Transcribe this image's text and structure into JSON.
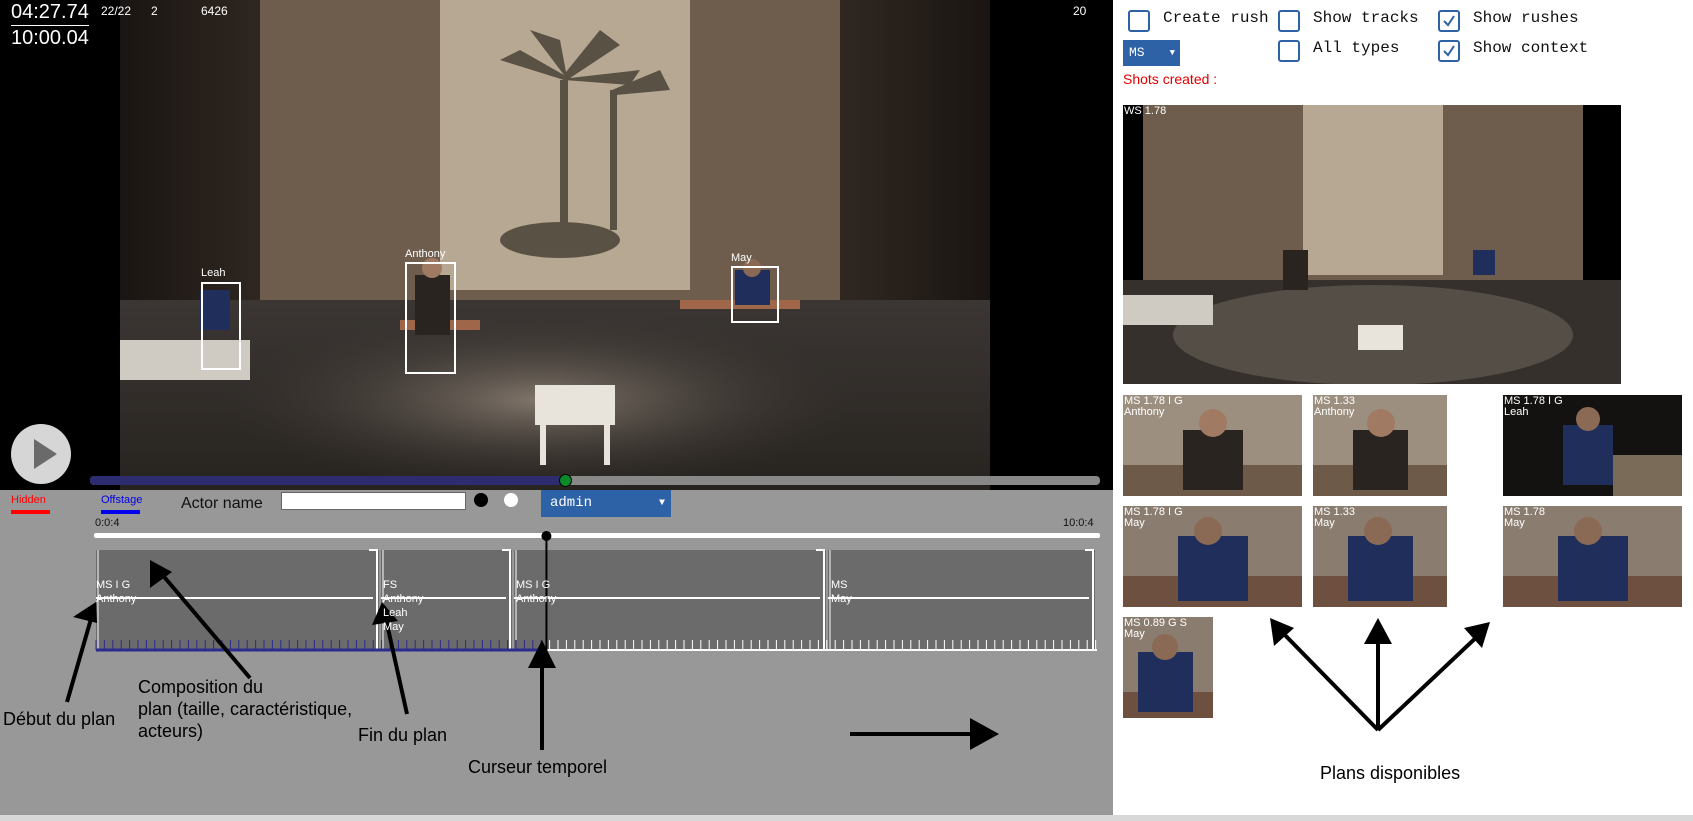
{
  "video": {
    "timecode": "04:27.74",
    "duration": "10:00.04",
    "frame_counter": "22/22",
    "stat_a": "2",
    "frame_number": "6426",
    "stat_b": "20",
    "progress": 0.47,
    "actors": [
      {
        "name": "Leah"
      },
      {
        "name": "Anthony"
      },
      {
        "name": "May"
      }
    ]
  },
  "controls": {
    "hidden_label": "Hidden",
    "offstage_label": "Offstage",
    "actor_name_label": "Actor name",
    "actor_name_value": "",
    "user_select": "admin",
    "hidden_color": "#ff0000",
    "offstage_color": "#0000ff"
  },
  "timeline": {
    "start_label": "0:0:4",
    "end_label": "10:0:4",
    "cursor_fraction": 0.45,
    "shots": [
      {
        "type": "MS I G",
        "actors": "Anthony"
      },
      {
        "type": "FS",
        "actors": "Anthony\nLeah\nMay"
      },
      {
        "type": "MS I G",
        "actors": "Anthony"
      },
      {
        "type": "MS",
        "actors": "May"
      }
    ]
  },
  "annotations": {
    "debut": "Début du plan",
    "composition": "Composition du\nplan (taille, caractéristique,\nacteurs)",
    "fin": "Fin du plan",
    "curseur": "Curseur temporel",
    "plans": "Plans disponibles"
  },
  "options": {
    "create_rush": {
      "label": "Create rush",
      "checked": false
    },
    "show_tracks": {
      "label": "Show tracks",
      "checked": false
    },
    "show_rushes": {
      "label": "Show rushes",
      "checked": true
    },
    "all_types": {
      "label": "All types",
      "checked": false
    },
    "show_context": {
      "label": "Show context",
      "checked": true
    },
    "shot_type_select": "MS",
    "shots_created": "Shots created :",
    "accent_color": "#2e62a6",
    "alert_color": "#e00000"
  },
  "rushes": {
    "main": {
      "label": "WS 1.78"
    },
    "thumbs": [
      {
        "label": "MS 1.78 I G\nAnthony"
      },
      {
        "label": "MS 1.33\nAnthony"
      },
      {
        "label": "MS 1.78 I G\nLeah"
      },
      {
        "label": "MS 1.78 I G\nMay"
      },
      {
        "label": "MS 1.33\nMay"
      },
      {
        "label": "MS 1.78\nMay"
      },
      {
        "label": "MS 0.89 G S\nMay"
      }
    ]
  }
}
